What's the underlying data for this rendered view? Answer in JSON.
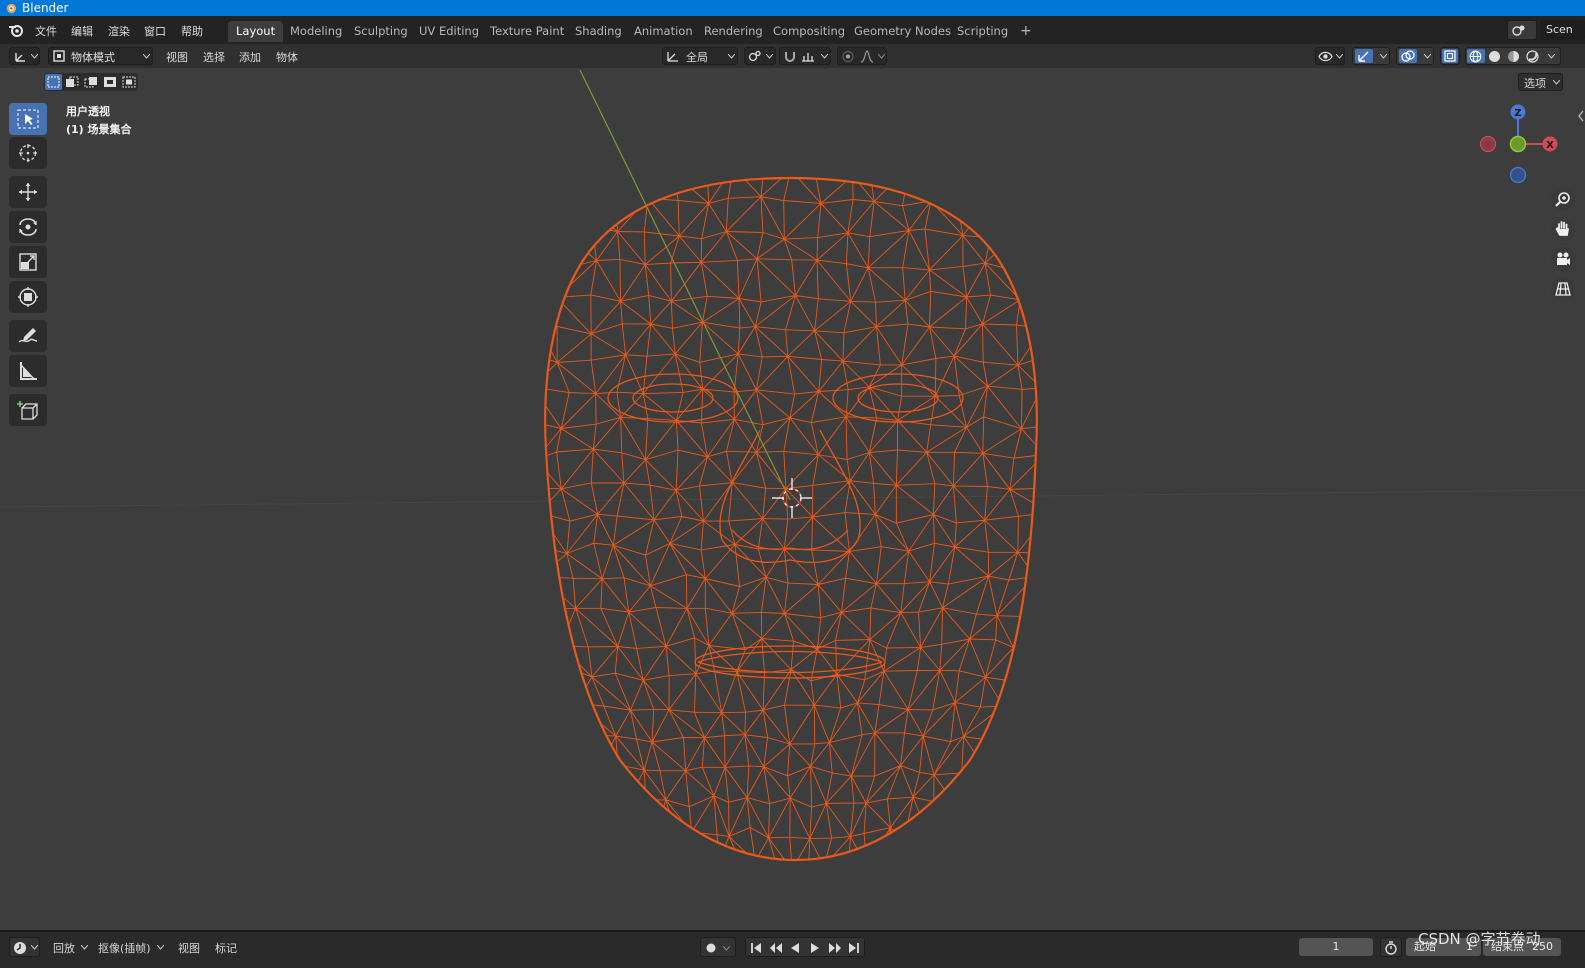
{
  "window": {
    "title": "Blender"
  },
  "menu": [
    "文件",
    "编辑",
    "渲染",
    "窗口",
    "帮助"
  ],
  "workspace_tabs": [
    {
      "label": "Layout",
      "active": true
    },
    {
      "label": "Modeling"
    },
    {
      "label": "Sculpting"
    },
    {
      "label": "UV Editing"
    },
    {
      "label": "Texture Paint"
    },
    {
      "label": "Shading"
    },
    {
      "label": "Animation"
    },
    {
      "label": "Rendering"
    },
    {
      "label": "Compositing"
    },
    {
      "label": "Geometry Nodes"
    },
    {
      "label": "Scripting"
    }
  ],
  "add_workspace": "+",
  "scene_label": "Scen",
  "viewport_header": {
    "mode": "物体模式",
    "menus": [
      "视图",
      "选择",
      "添加",
      "物体"
    ],
    "transform_orientation": "全局",
    "options": "选项"
  },
  "viewport": {
    "perspective": "用户透视",
    "collection": "(1) 场景集合",
    "gizmo": {
      "x": "X",
      "y": "Y",
      "z": "Z"
    }
  },
  "timeline": {
    "playback": "回放",
    "keying": "抠像(插帧)",
    "view": "视图",
    "marker": "标记",
    "current_frame": "1",
    "start_label": "起始",
    "start_value": "1",
    "end_label": "结束点",
    "end_value": "250"
  },
  "watermark": "CSDN @字节卷动",
  "colors": {
    "wire": "#e8591a",
    "accent": "#4772b3",
    "titlebar": "#0078d7"
  },
  "icons": [
    "blender-logo-icon",
    "select-box-icon",
    "cursor-icon",
    "move-icon",
    "rotate-icon",
    "scale-icon",
    "transform-icon",
    "annotate-icon",
    "measure-icon",
    "add-cube-icon",
    "zoom-icon",
    "hand-icon",
    "camera-icon",
    "grid-icon"
  ]
}
